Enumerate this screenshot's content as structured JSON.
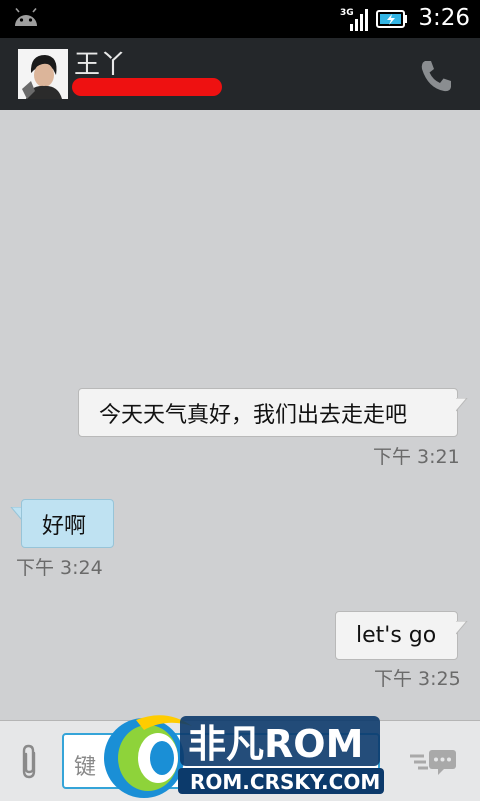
{
  "status_bar": {
    "network": "3G",
    "time": "3:26"
  },
  "header": {
    "contact_name": "王丫"
  },
  "messages": [
    {
      "direction": "outgoing",
      "text": "今天天气真好，我们出去走走吧",
      "time": "下午 3:21"
    },
    {
      "direction": "incoming",
      "text": "好啊",
      "time": "下午 3:24"
    },
    {
      "direction": "outgoing",
      "text": "let's go",
      "time": "下午 3:25"
    }
  ],
  "compose": {
    "value": "键"
  },
  "watermark": {
    "brand": "非凡ROM",
    "url": "ROM.CRSKY.COM"
  },
  "colors": {
    "accent": "#35a4d8",
    "incoming_bubble": "#bfe2f2",
    "outgoing_bubble": "#f3f3f3"
  }
}
